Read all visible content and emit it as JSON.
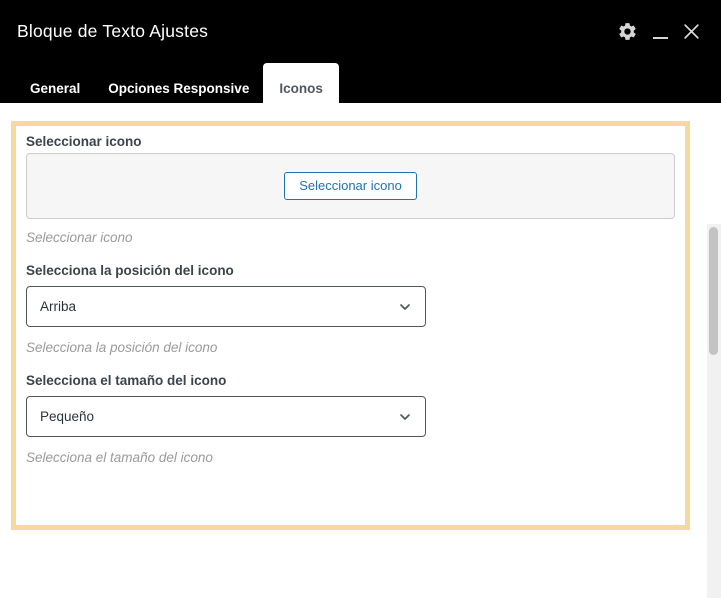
{
  "window": {
    "title": "Bloque de Texto Ajustes",
    "controls": {
      "settings_icon": "gear-icon",
      "minimize_icon": "minimize-icon",
      "close_icon": "close-icon"
    }
  },
  "tabs": {
    "items": [
      {
        "label": "General",
        "active": false
      },
      {
        "label": "Opciones Responsive",
        "active": false
      },
      {
        "label": "Iconos",
        "active": true
      }
    ]
  },
  "panel": {
    "icon_picker": {
      "label": "Seleccionar icono",
      "button": "Seleccionar icono",
      "helper": "Seleccionar icono"
    },
    "icon_position": {
      "label": "Selecciona la posición del icono",
      "value": "Arriba",
      "helper": "Selecciona la posición del icono"
    },
    "icon_size": {
      "label": "Selecciona el tamaño del icono",
      "value": "Pequeño",
      "helper": "Selecciona el tamaño del icono"
    }
  },
  "colors": {
    "header_bg": "#000000",
    "accent_border": "#f6d8a0",
    "button_blue": "#2271b1",
    "label_text": "#3c434a",
    "helper_text": "#9a9a9a",
    "select_border": "#50575e"
  }
}
